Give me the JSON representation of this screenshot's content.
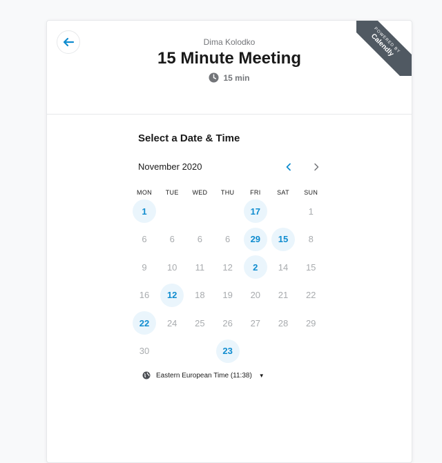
{
  "header": {
    "organizer": "Dima Kolodko",
    "title": "15 Minute Meeting",
    "duration": "15 min",
    "badge_top": "POWERED BY",
    "badge_brand": "Calendly"
  },
  "calendar": {
    "heading": "Select a Date & Time",
    "month": "November 2020",
    "weekdays": [
      "MON",
      "TUE",
      "WED",
      "THU",
      "FRI",
      "SAT",
      "SUN"
    ],
    "days": [
      {
        "label": "1",
        "col": 0,
        "row": 0,
        "available": true
      },
      {
        "label": "17",
        "col": 4,
        "row": 0,
        "available": true
      },
      {
        "label": "1",
        "col": 6,
        "row": 0,
        "available": false
      },
      {
        "label": "6",
        "col": 0,
        "row": 1,
        "available": false
      },
      {
        "label": "6",
        "col": 1,
        "row": 1,
        "available": false
      },
      {
        "label": "6",
        "col": 2,
        "row": 1,
        "available": false
      },
      {
        "label": "6",
        "col": 3,
        "row": 1,
        "available": false
      },
      {
        "label": "29",
        "col": 4,
        "row": 1,
        "available": true
      },
      {
        "label": "15",
        "col": 5,
        "row": 1,
        "available": true
      },
      {
        "label": "8",
        "col": 6,
        "row": 1,
        "available": false
      },
      {
        "label": "9",
        "col": 0,
        "row": 2,
        "available": false
      },
      {
        "label": "10",
        "col": 1,
        "row": 2,
        "available": false
      },
      {
        "label": "11",
        "col": 2,
        "row": 2,
        "available": false
      },
      {
        "label": "12",
        "col": 3,
        "row": 2,
        "available": false
      },
      {
        "label": "2",
        "col": 4,
        "row": 2,
        "available": true
      },
      {
        "label": "14",
        "col": 5,
        "row": 2,
        "available": false
      },
      {
        "label": "15",
        "col": 6,
        "row": 2,
        "available": false
      },
      {
        "label": "16",
        "col": 0,
        "row": 3,
        "available": false
      },
      {
        "label": "12",
        "col": 1,
        "row": 3,
        "available": true
      },
      {
        "label": "18",
        "col": 2,
        "row": 3,
        "available": false
      },
      {
        "label": "19",
        "col": 3,
        "row": 3,
        "available": false
      },
      {
        "label": "20",
        "col": 4,
        "row": 3,
        "available": false
      },
      {
        "label": "21",
        "col": 5,
        "row": 3,
        "available": false
      },
      {
        "label": "22",
        "col": 6,
        "row": 3,
        "available": false
      },
      {
        "label": "22",
        "col": 0,
        "row": 4,
        "available": true
      },
      {
        "label": "24",
        "col": 1,
        "row": 4,
        "available": false
      },
      {
        "label": "25",
        "col": 2,
        "row": 4,
        "available": false
      },
      {
        "label": "26",
        "col": 3,
        "row": 4,
        "available": false
      },
      {
        "label": "27",
        "col": 4,
        "row": 4,
        "available": false
      },
      {
        "label": "28",
        "col": 5,
        "row": 4,
        "available": false
      },
      {
        "label": "29",
        "col": 6,
        "row": 4,
        "available": false
      },
      {
        "label": "30",
        "col": 0,
        "row": 5,
        "available": false
      },
      {
        "label": "23",
        "col": 3,
        "row": 5,
        "available": true
      }
    ],
    "timezone": "Eastern European Time (11:38)"
  },
  "icons": {
    "back": "arrow-left-icon",
    "clock": "clock-icon",
    "globe": "globe-icon",
    "prev": "chevron-left-icon",
    "next": "chevron-right-icon"
  },
  "colors": {
    "accent": "#0f8ccf",
    "available_bg": "#eaf5fc",
    "ribbon": "#505962"
  }
}
